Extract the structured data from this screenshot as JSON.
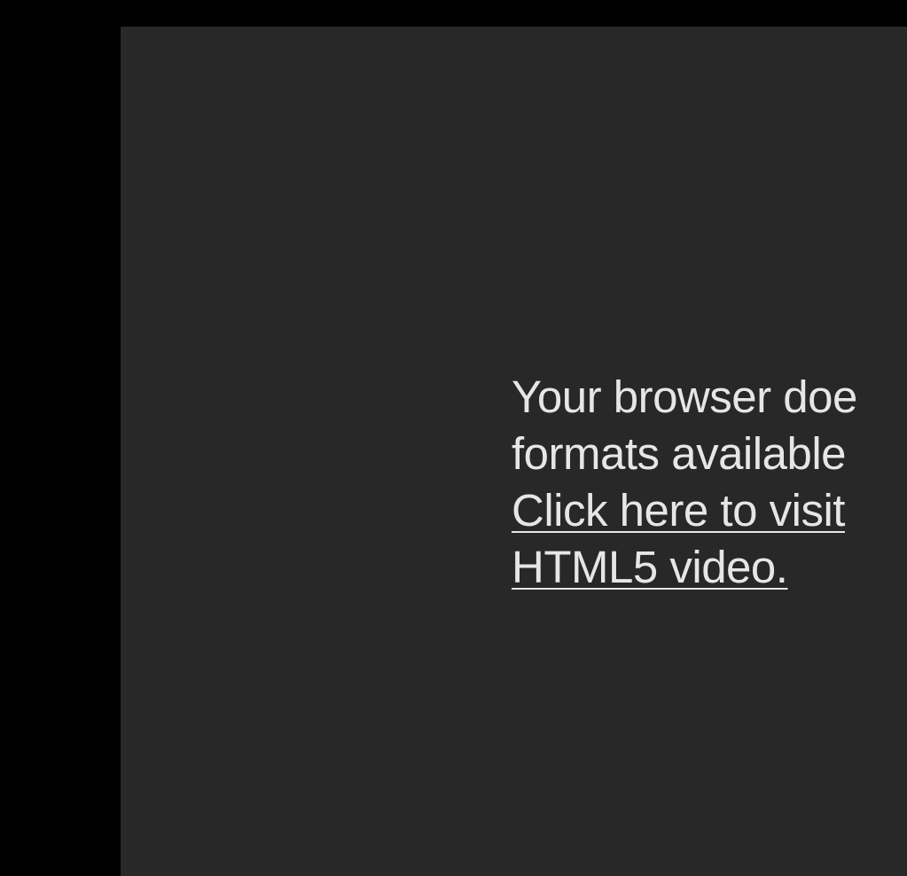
{
  "colors": {
    "outer_background": "#000000",
    "player_background": "#282828",
    "text": "#e6e6e6"
  },
  "video_fallback": {
    "message_line1": "Your browser doe",
    "message_line2": "formats available",
    "link_line1": "Click here to visit",
    "link_line2": "HTML5 video."
  }
}
